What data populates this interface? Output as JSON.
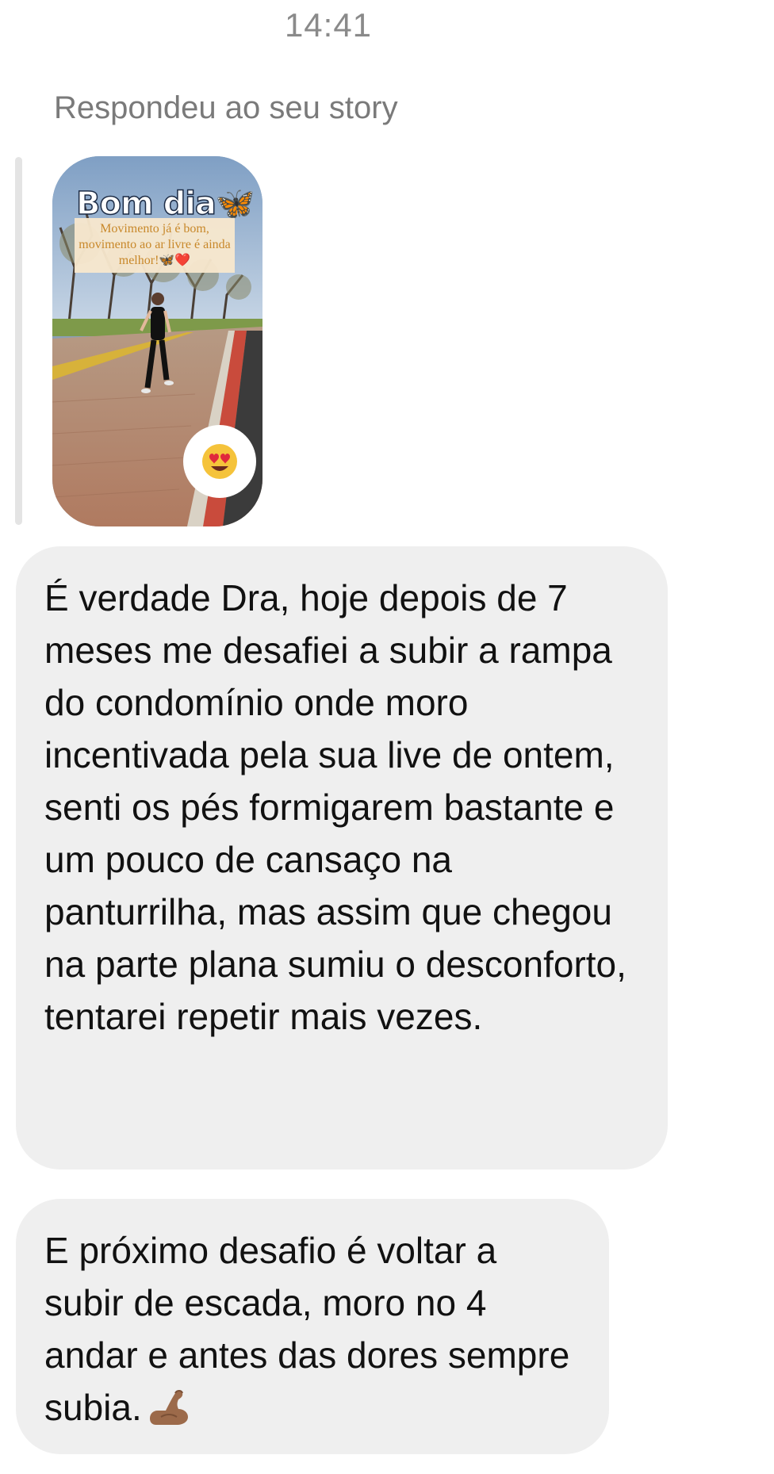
{
  "header": {
    "time": "14:41"
  },
  "story_reply": {
    "label": "Respondeu ao seu story",
    "story": {
      "title": "Bom dia🦋",
      "caption": "Movimento já é bom, movimento ao ar livre é ainda melhor!🦋❤️"
    },
    "reaction_icon": "heart-eyes-emoji-icon"
  },
  "messages": [
    {
      "text": "É verdade Dra, hoje depois de 7 meses me desafiei a subir a rampa do condomínio onde moro incentivada pela sua live de ontem, senti os pés formigarem bastante e um pouco de cansaço na panturrilha, mas assim que chegou na parte plana sumiu o desconforto, tentarei repetir mais vezes."
    },
    {
      "text": "E próximo desafio é voltar a subir de escada, moro no 4 andar e antes das dores sempre subia.",
      "trailing_icon": "flexed-biceps-emoji-icon"
    }
  ],
  "colors": {
    "bubble_background": "#efefef",
    "secondary_text": "#7a7a7a",
    "reply_bar": "#e4e4e4"
  }
}
